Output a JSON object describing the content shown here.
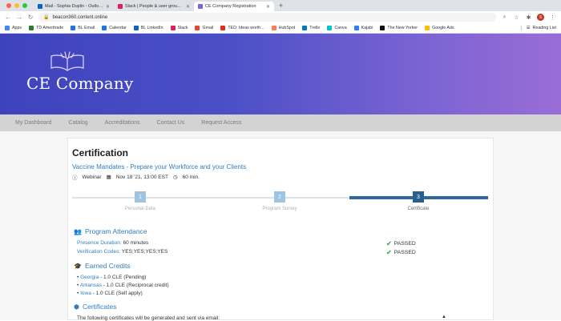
{
  "browser": {
    "tabs": [
      {
        "label": "Mail - Sophia Duplin - Outlook",
        "color": "#0a64c8"
      },
      {
        "label": "Slack | People & user groups |",
        "color": "#e01e5a"
      },
      {
        "label": "CE Company Registration",
        "color": "#7a63d3"
      }
    ],
    "new_tab": "+",
    "url": "beacon360.content.online",
    "profile_initial": "S",
    "bookmarks": [
      {
        "label": "Apps",
        "color": "#4285f4"
      },
      {
        "label": "TD Ameritrade",
        "color": "#2e7d32"
      },
      {
        "label": "BL Email",
        "color": "#1a73e8"
      },
      {
        "label": "Calendar",
        "color": "#1a73e8"
      },
      {
        "label": "BL LinkedIn",
        "color": "#0a66c2"
      },
      {
        "label": "Slack",
        "color": "#e01e5a"
      },
      {
        "label": "Gmail",
        "color": "#ea4335"
      },
      {
        "label": "TED: Ideas worth...",
        "color": "#e62b1e"
      },
      {
        "label": "HubSpot",
        "color": "#ff7a59"
      },
      {
        "label": "Trello",
        "color": "#0079bf"
      },
      {
        "label": "Canva",
        "color": "#00c4cc"
      },
      {
        "label": "Kajabi",
        "color": "#2f80ed"
      },
      {
        "label": "The New Yorker",
        "color": "#111111"
      },
      {
        "label": "Google Ads",
        "color": "#fbbc04"
      }
    ],
    "reading_list": "Reading List"
  },
  "site": {
    "brand": "CE Company",
    "nav": [
      "My Dashboard",
      "Catalog",
      "Accreditations",
      "Contact Us",
      "Request Access"
    ]
  },
  "certification": {
    "title": "Certification",
    "event_title": "Vaccine Mandates - Prepare your Workforce and your Clients",
    "format": "Webinar",
    "date": "Nov 18 '21, 13:00 EST",
    "duration": "60 min.",
    "steps": [
      {
        "number": "1",
        "label": "Personal Data"
      },
      {
        "number": "2",
        "label": "Program Survey"
      },
      {
        "number": "3",
        "label": "Certificate"
      }
    ],
    "attendance": {
      "title": "Program Attendance",
      "presence_label": "Presence Duration:",
      "presence_value": "60 minutes",
      "verification_label": "Verification Codes:",
      "verification_value": "YES;YES;YES;YES",
      "status": "PASSED"
    },
    "credits": {
      "title": "Earned Credits",
      "items": [
        {
          "state": "Georgia",
          "detail": " - 1.0 CLE (Pending)"
        },
        {
          "state": "Arkansas",
          "detail": " - 1.0 CLE (Reciprocal credit)"
        },
        {
          "state": "Iowa",
          "detail": " - 1.0 CLE (Self apply)"
        }
      ]
    },
    "certificates": {
      "title": "Certificates",
      "notice": "The following certificates will be generated and sent via email:"
    }
  },
  "colors": {
    "accent": "#2f7ec0",
    "step_active": "#285f91",
    "step_inactive": "#9dc4e3",
    "pass": "#4caf50"
  }
}
